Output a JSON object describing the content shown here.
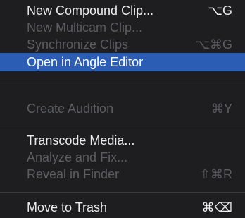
{
  "menu": {
    "items": [
      {
        "label": "New Compound Clip...",
        "shortcut": "⌥G"
      },
      {
        "label": "New Multicam Clip...",
        "shortcut": ""
      },
      {
        "label": "Synchronize Clips",
        "shortcut": "⌥⌘G"
      },
      {
        "label": "Open in Angle Editor",
        "shortcut": ""
      },
      {
        "label": "Create Audition",
        "shortcut": "⌘Y"
      },
      {
        "label": "Transcode Media...",
        "shortcut": ""
      },
      {
        "label": "Analyze and Fix...",
        "shortcut": ""
      },
      {
        "label": "Reveal in Finder",
        "shortcut": "⇧⌘R"
      },
      {
        "label": "Move to Trash",
        "shortcut": "⌘⌫"
      }
    ]
  },
  "colors": {
    "background": "#1e1e20",
    "enabled_text": "#ebebeb",
    "disabled_text": "#5c5d61",
    "highlight": "#2a5db3",
    "separator": "#3a3a3d"
  }
}
